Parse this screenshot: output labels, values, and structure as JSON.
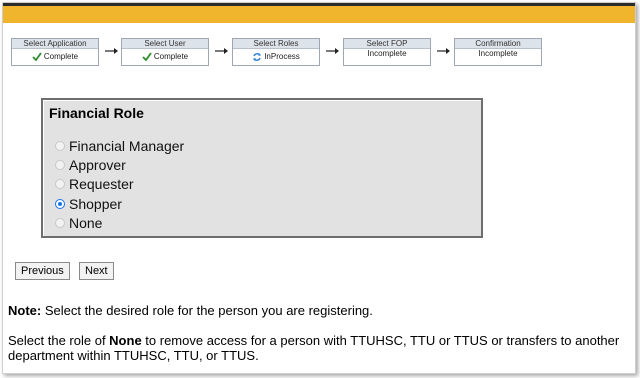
{
  "steps": [
    {
      "title": "Select Application",
      "status": "Complete",
      "icon": "check-icon"
    },
    {
      "title": "Select User",
      "status": "Complete",
      "icon": "check-icon"
    },
    {
      "title": "Select Roles",
      "status": "InProcess",
      "icon": "sync-icon"
    },
    {
      "title": "Select FOP",
      "status": "Incomplete",
      "icon": ""
    },
    {
      "title": "Confirmation",
      "status": "Incomplete",
      "icon": ""
    }
  ],
  "role_section": {
    "title": "Financial Role",
    "options": [
      {
        "label": "Financial Manager",
        "selected": false
      },
      {
        "label": "Approver",
        "selected": false
      },
      {
        "label": "Requester",
        "selected": false
      },
      {
        "label": "Shopper",
        "selected": true
      },
      {
        "label": "None",
        "selected": false
      }
    ]
  },
  "buttons": {
    "previous": "Previous",
    "next": "Next"
  },
  "note": {
    "label": "Note:",
    "text": " Select the desired role for the person you are registering.",
    "line2_pre": "Select the role of ",
    "line2_bold": "None",
    "line2_post": " to remove access for a person with TTUHSC, TTU or TTUS or transfers to another department within TTUHSC, TTU, or TTUS."
  },
  "colors": {
    "accent_bar": "#f0b52d",
    "check": "#2e8b2e",
    "selected_radio": "#1a73e8"
  }
}
